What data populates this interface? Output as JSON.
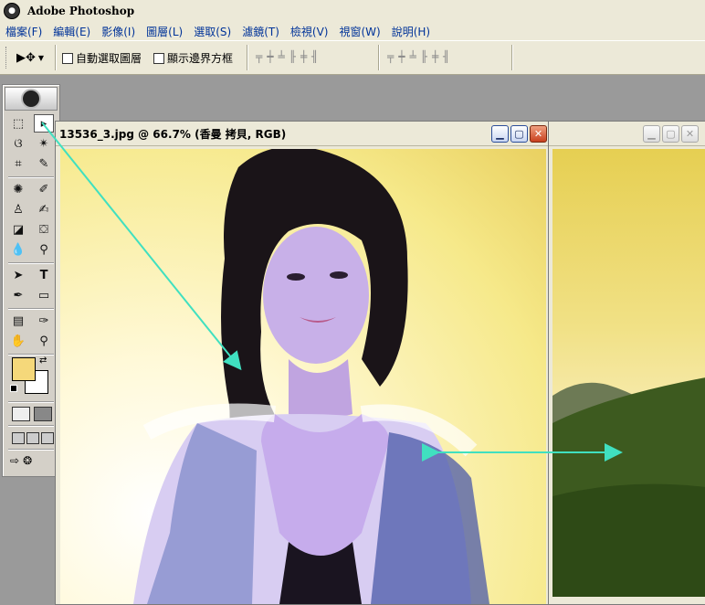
{
  "app": {
    "title": "Adobe Photoshop",
    "icon": "photoshop-eye-icon"
  },
  "menus": [
    "檔案(F)",
    "編輯(E)",
    "影像(I)",
    "圖層(L)",
    "選取(S)",
    "濾鏡(T)",
    "檢視(V)",
    "視窗(W)",
    "說明(H)"
  ],
  "options": {
    "tool_preset_icon": "move-tool-icon",
    "auto_select_layer": "自動選取圖層",
    "show_bounding_box": "顯示邊界方框"
  },
  "document1": {
    "title": "13536_3.jpg @ 66.7% (香曼 拷貝, RGB)"
  },
  "colors": {
    "foreground": "#f5d87a",
    "background": "#ffffff",
    "arrow": "#40e0c0"
  }
}
